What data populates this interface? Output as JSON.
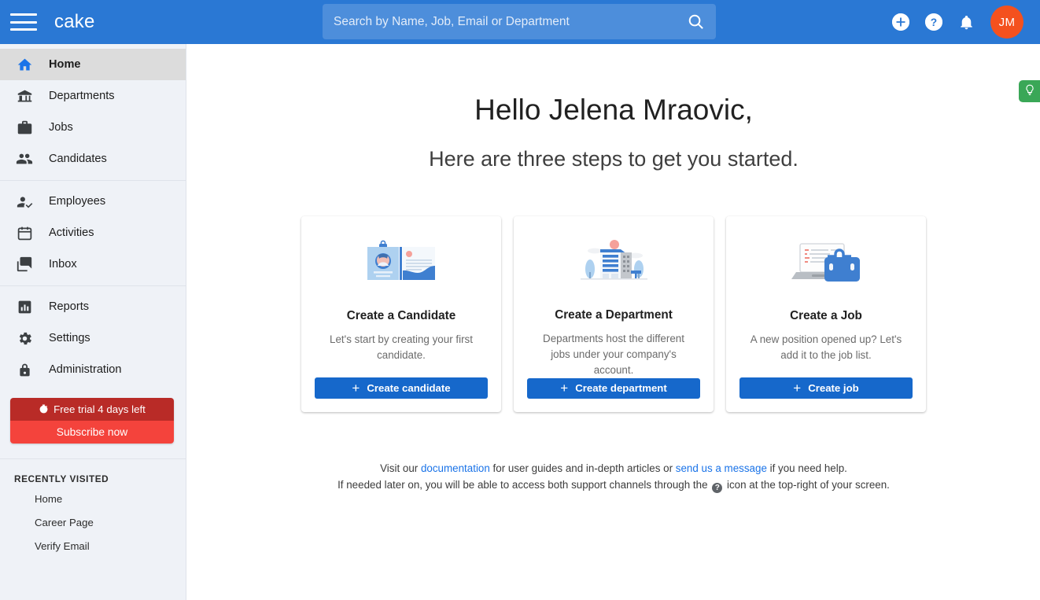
{
  "header": {
    "brand": "cake",
    "menu_icon": "hamburger-menu-icon",
    "search": {
      "placeholder": "Search by Name, Job, Email or Department",
      "value": "",
      "icon": "search-icon"
    },
    "actions": [
      {
        "name": "add-icon",
        "label": "+"
      },
      {
        "name": "help-icon",
        "label": "?"
      },
      {
        "name": "notifications-bell-icon",
        "label": ""
      }
    ],
    "avatar_initials": "JM",
    "colors": {
      "bar": "#2a78d4",
      "avatar": "#f4511e"
    }
  },
  "sidebar": {
    "groups": [
      {
        "items": [
          {
            "label": "Home",
            "icon": "home-icon",
            "active": true
          },
          {
            "label": "Departments",
            "icon": "bank-icon",
            "active": false
          },
          {
            "label": "Jobs",
            "icon": "briefcase-icon",
            "active": false
          },
          {
            "label": "Candidates",
            "icon": "people-icon",
            "active": false
          }
        ]
      },
      {
        "items": [
          {
            "label": "Employees",
            "icon": "person-check-icon",
            "active": false
          },
          {
            "label": "Activities",
            "icon": "calendar-icon",
            "active": false
          },
          {
            "label": "Inbox",
            "icon": "chat-icon",
            "active": false
          }
        ]
      },
      {
        "items": [
          {
            "label": "Reports",
            "icon": "bar-chart-icon",
            "active": false
          },
          {
            "label": "Settings",
            "icon": "gear-icon",
            "active": false
          },
          {
            "label": "Administration",
            "icon": "lock-icon",
            "active": false
          }
        ]
      }
    ],
    "trial": {
      "icon": "timer-icon",
      "status": "Free trial 4 days left",
      "cta": "Subscribe now",
      "colors": {
        "top": "#b92b27",
        "bottom": "#f4433c"
      }
    },
    "recently_visited": {
      "title": "RECENTLY VISITED",
      "items": [
        "Home",
        "Career Page",
        "Verify Email"
      ]
    }
  },
  "main": {
    "greeting": "Hello Jelena Mraovic,",
    "subgreeting": "Here are three steps to get you started.",
    "cards": [
      {
        "art": "resume-clipboard-illustration",
        "title": "Create a Candidate",
        "desc": "Let's start by creating your first candidate.",
        "button": "Create candidate",
        "button_icon": "plus-icon"
      },
      {
        "art": "office-building-illustration",
        "title": "Create a Department",
        "desc": "Departments host the different jobs under your company's account.",
        "button": "Create department",
        "button_icon": "plus-icon"
      },
      {
        "art": "laptop-briefcase-illustration",
        "title": "Create a Job",
        "desc": "A new position opened up? Let's add it to the job list.",
        "button": "Create job",
        "button_icon": "plus-icon"
      }
    ],
    "footer": {
      "line1_a": "Visit our ",
      "link_docs": "documentation",
      "line1_b": " for user guides and in-depth articles or ",
      "link_message": "send us a message",
      "line1_c": " if you need help.",
      "line2_a": "If needed later on, you will be able to access both support channels through the ",
      "help_glyph": "?",
      "line2_b": " icon at the top-right of your screen."
    }
  },
  "tip_tab": {
    "icon": "lightbulb-icon",
    "color": "#3aa757"
  }
}
